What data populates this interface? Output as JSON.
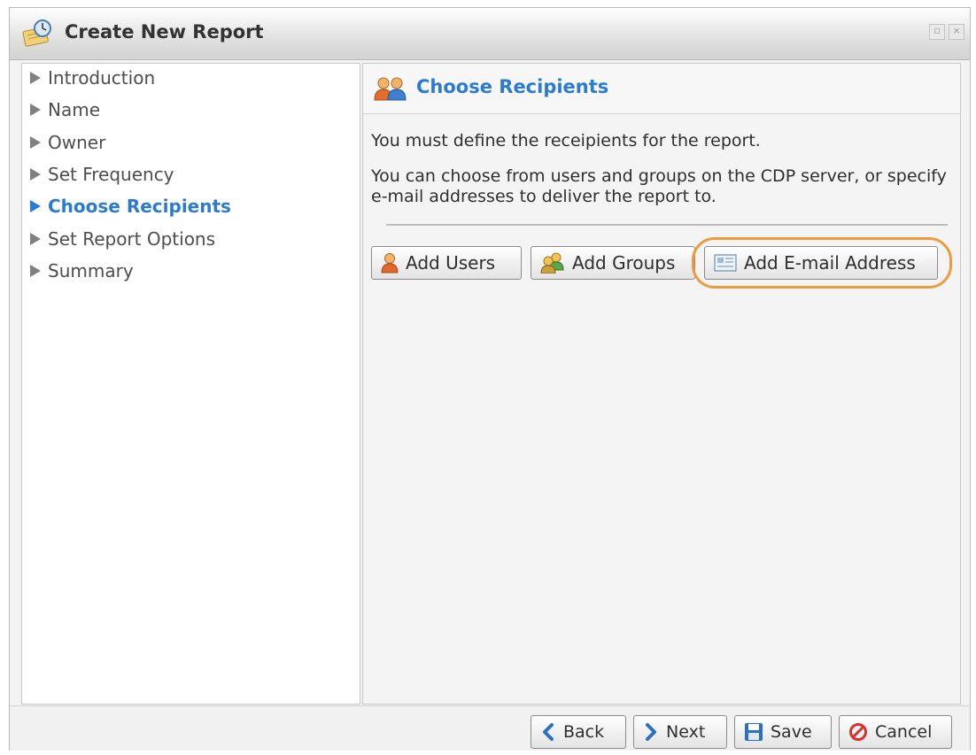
{
  "window": {
    "title": "Create New Report",
    "title_icon": "scheduled-report-icon",
    "window_buttons": [
      "restore-icon",
      "close-icon"
    ]
  },
  "nav": {
    "items": [
      {
        "label": "Introduction",
        "active": false
      },
      {
        "label": "Name",
        "active": false
      },
      {
        "label": "Owner",
        "active": false
      },
      {
        "label": "Set Frequency",
        "active": false
      },
      {
        "label": "Choose Recipients",
        "active": true
      },
      {
        "label": "Set Report Options",
        "active": false
      },
      {
        "label": "Summary",
        "active": false
      }
    ]
  },
  "content": {
    "header_icon": "users-group-icon",
    "title": "Choose Recipients",
    "text1": "You must define the receipients for the report.",
    "text2": "You can choose from users and groups on the CDP server, or specify e-mail addresses to deliver the report to.",
    "buttons": {
      "add_users": "Add Users",
      "add_groups": "Add Groups",
      "add_email": "Add E-mail Address"
    }
  },
  "footer": {
    "back": "Back",
    "next": "Next",
    "save": "Save",
    "cancel": "Cancel"
  },
  "colors": {
    "accent": "#2b7bd1",
    "highlight": "#ef9a3c"
  }
}
